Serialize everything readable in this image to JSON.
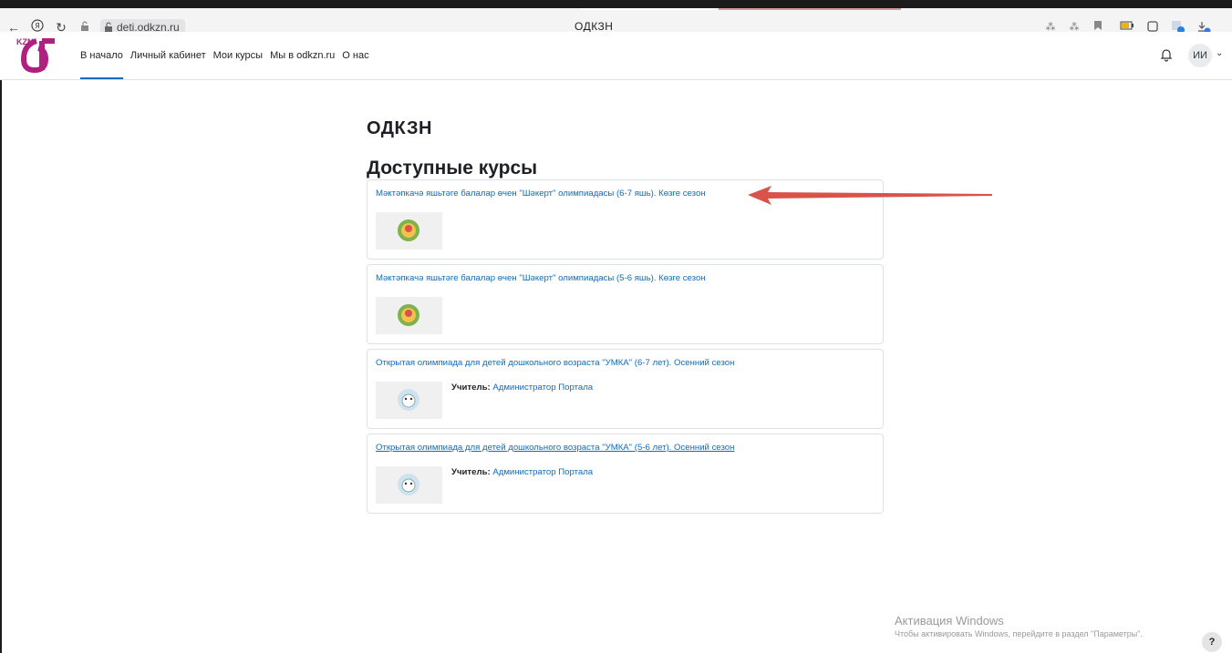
{
  "browser": {
    "url": "deti.odkzn.ru",
    "tab_title": "ОДКЗН"
  },
  "navbar": {
    "logo_text": "KZN",
    "items": [
      {
        "label": "В начало",
        "active": true
      },
      {
        "label": "Личный кабинет",
        "active": false
      },
      {
        "label": "Мои курсы",
        "active": false
      },
      {
        "label": "Мы в odkzn.ru",
        "active": false
      },
      {
        "label": "О нас",
        "active": false
      }
    ],
    "avatar_initials": "ИИ"
  },
  "main": {
    "site_title": "ОДКЗН",
    "section_title": "Доступные курсы",
    "courses": [
      {
        "title": "Мәктәпкачә яшьтәге балалар өчен \"Шәкерт\" олимпиадасы (6-7 яшь). Көзге сезон"
      },
      {
        "title": "Мәктәпкачә яшьтәге балалар өчен \"Шәкерт\" олимпиадасы (5-6 яшь). Көзге сезон"
      },
      {
        "title": "Открытая олимпиада для детей дошкольного возраста \"УМКА\" (6-7 лет). Осенний сезон",
        "teacher_label": "Учитель:",
        "teacher_name": "Администратор Портала"
      },
      {
        "title": "Открытая олимпиада для детей дошкольного возраста \"УМКА\" (5-6 лет). Осенний сезон",
        "teacher_label": "Учитель:",
        "teacher_name": "Администратор Портала"
      }
    ]
  },
  "windows_activation": {
    "title": "Активация Windows",
    "subtitle": "Чтобы активировать Windows, перейдите в раздел \"Параметры\"."
  },
  "help_label": "?",
  "colors": {
    "link": "#0f6cbf",
    "arrow": "#d9534a",
    "logo": "#b0217f"
  }
}
